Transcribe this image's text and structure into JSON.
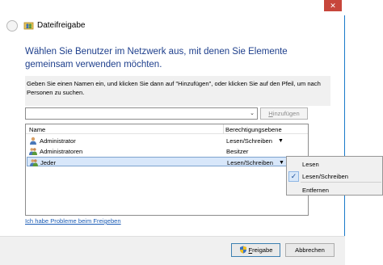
{
  "window": {
    "title": "Dateifreigabe",
    "close_glyph": "✕"
  },
  "main": {
    "heading": "Wählen Sie Benutzer im Netzwerk aus, mit denen Sie Elemente gemeinsam verwenden möchten.",
    "instruction": "Geben Sie einen Namen ein, und klicken Sie dann auf \"Hinzufügen\", oder klicken Sie auf den Pfeil, um nach Personen zu suchen.",
    "name_input_value": "",
    "add_button": {
      "prefix": "",
      "underlined": "H",
      "rest": "inzufügen"
    }
  },
  "table": {
    "columns": [
      "Name",
      "Berechtigungsebene"
    ],
    "rows": [
      {
        "name": "Administrator",
        "level": "Lesen/Schreiben",
        "has_arrow": true,
        "icon": "user-icon"
      },
      {
        "name": "Administratoren",
        "level": "Besitzer",
        "has_arrow": false,
        "icon": "group-icon"
      },
      {
        "name": "Jeder",
        "level": "Lesen/Schreiben",
        "has_arrow": true,
        "icon": "group-icon",
        "selected": true
      }
    ],
    "arrow_glyph": "▼"
  },
  "help_link": "Ich habe Probleme beim Freigeben",
  "footer": {
    "share_button": {
      "underlined": "F",
      "rest": "reigabe"
    },
    "cancel_button": "Abbrechen"
  },
  "context_menu": {
    "items": [
      {
        "label": "Lesen",
        "checked": false
      },
      {
        "label": "Lesen/Schreiben",
        "checked": true
      },
      {
        "label": "Entfernen",
        "checked": false
      }
    ],
    "check_glyph": "✓"
  },
  "colors": {
    "heading": "#1e3f8c",
    "link": "#1a5bb5",
    "selection": "#d8e7fa",
    "close_button": "#c7463b"
  }
}
